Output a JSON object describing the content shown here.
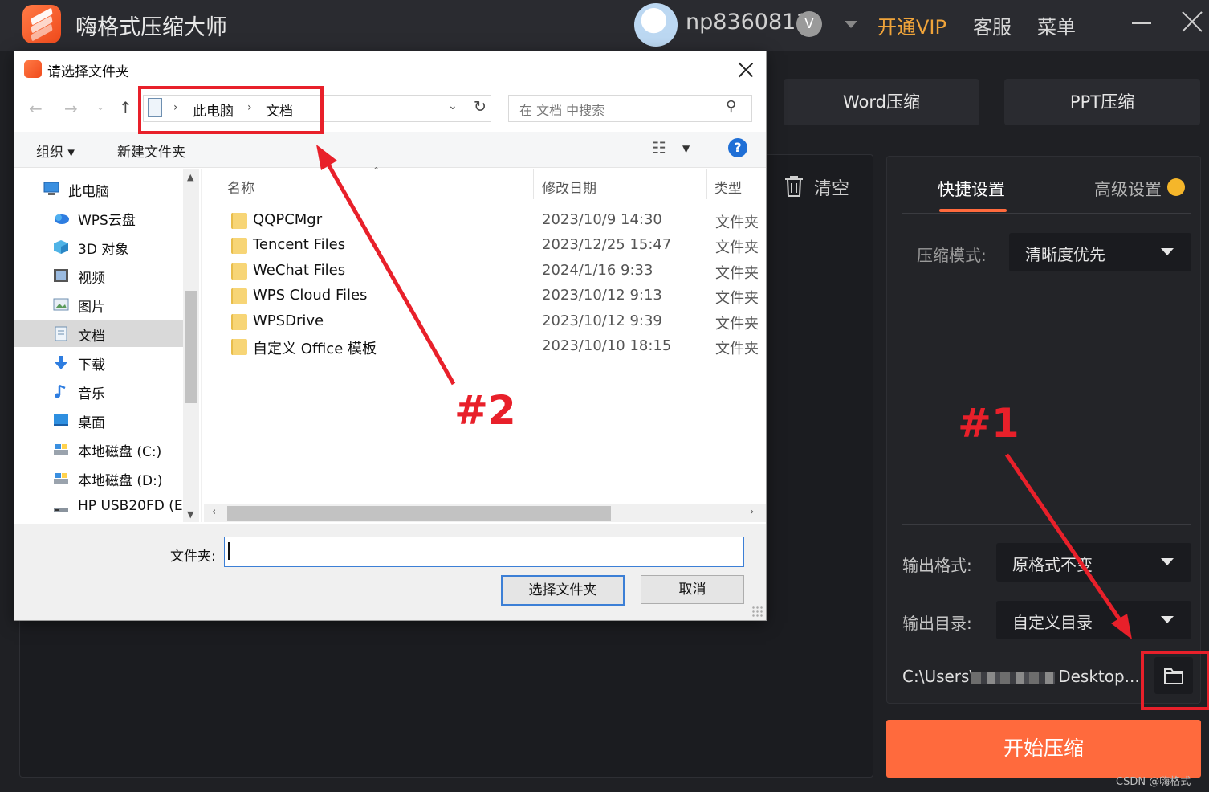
{
  "app": {
    "title": "嗨格式压缩大师",
    "username": "np8360811",
    "vip_badge": "V",
    "vip_link": "开通VIP",
    "service": "客服",
    "menu": "菜单"
  },
  "tabs": {
    "word": "Word压缩",
    "ppt": "PPT压缩"
  },
  "file_list": {
    "clear": "清空"
  },
  "settings": {
    "tab_quick": "快捷设置",
    "tab_advanced": "高级设置",
    "mode_label": "压缩模式:",
    "mode_value": "清晰度优先",
    "format_label": "输出格式:",
    "format_value": "原格式不变",
    "dir_label": "输出目录:",
    "dir_value": "自定义目录",
    "path_prefix": "C:\\Users\\",
    "path_suffix": "Desktop...",
    "start": "开始压缩"
  },
  "watermark": "CSDN @嗨格式",
  "dialog": {
    "title": "请选择文件夹",
    "breadcrumb": [
      "此电脑",
      "文档"
    ],
    "search_placeholder": "在 文档 中搜索",
    "organize": "组织 ▾",
    "new_folder": "新建文件夹",
    "help": "?",
    "nav_items": [
      {
        "label": "此电脑",
        "icon": "computer-icon"
      },
      {
        "label": "WPS云盘",
        "icon": "cloud-icon"
      },
      {
        "label": "3D 对象",
        "icon": "cube-icon"
      },
      {
        "label": "视频",
        "icon": "video-icon"
      },
      {
        "label": "图片",
        "icon": "picture-icon"
      },
      {
        "label": "文档",
        "icon": "document-icon"
      },
      {
        "label": "下载",
        "icon": "download-icon"
      },
      {
        "label": "音乐",
        "icon": "music-icon"
      },
      {
        "label": "桌面",
        "icon": "desktop-icon"
      },
      {
        "label": "本地磁盘 (C:)",
        "icon": "drive-icon"
      },
      {
        "label": "本地磁盘 (D:)",
        "icon": "drive-icon"
      },
      {
        "label": "HP USB20FD (E",
        "icon": "usb-drive-icon"
      }
    ],
    "columns": {
      "name": "名称",
      "date": "修改日期",
      "type": "类型"
    },
    "rows": [
      {
        "name": "QQPCMgr",
        "date": "2023/10/9 14:30",
        "type": "文件夹"
      },
      {
        "name": "Tencent Files",
        "date": "2023/12/25 15:47",
        "type": "文件夹"
      },
      {
        "name": "WeChat Files",
        "date": "2024/1/16 9:33",
        "type": "文件夹"
      },
      {
        "name": "WPS Cloud Files",
        "date": "2023/10/12 9:13",
        "type": "文件夹"
      },
      {
        "name": "WPSDrive",
        "date": "2023/10/12 9:39",
        "type": "文件夹"
      },
      {
        "name": "自定义 Office 模板",
        "date": "2023/10/10 18:15",
        "type": "文件夹"
      }
    ],
    "folder_label": "文件夹:",
    "folder_value": "",
    "select_button": "选择文件夹",
    "cancel_button": "取消"
  },
  "annotations": {
    "marker_1": "#1",
    "marker_2": "#2",
    "color": "#e8202a"
  },
  "colors": {
    "accent": "#ff6a3d",
    "vip": "#f0a43a",
    "dialog_focus": "#3c7fd6"
  }
}
